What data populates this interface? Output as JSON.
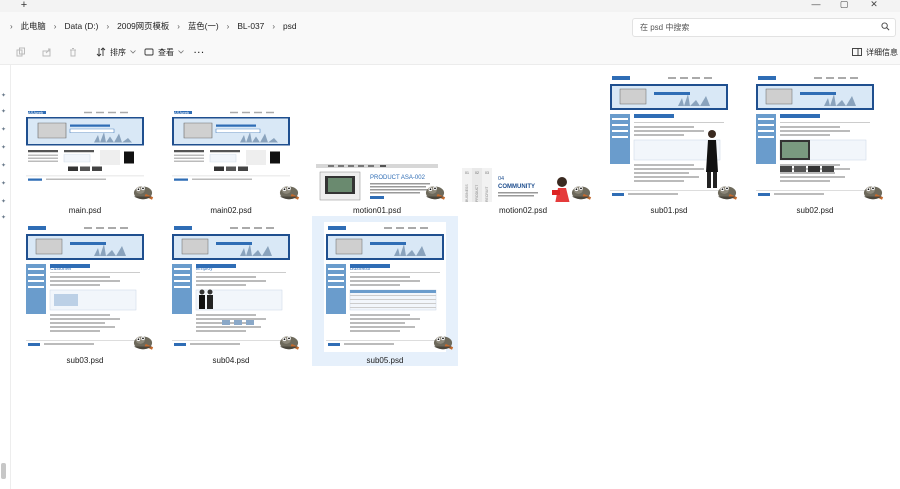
{
  "window": {
    "new_tab": "+",
    "minimize": "—",
    "maximize": "▢",
    "close": "✕"
  },
  "breadcrumb": [
    "此电脑",
    "Data (D:)",
    "2009网页模板",
    "蓝色(一)",
    "BL-037",
    "psd"
  ],
  "breadcrumb_sep": "›",
  "search": {
    "placeholder": "在 psd 中搜索"
  },
  "toolbar": {
    "sort_label": "排序",
    "view_label": "查看",
    "more_label": "···",
    "details_label": "详细信息"
  },
  "files": [
    {
      "name": "main.psd",
      "selected": false
    },
    {
      "name": "main02.psd",
      "selected": false
    },
    {
      "name": "motion01.psd",
      "selected": false
    },
    {
      "name": "motion02.psd",
      "selected": false
    },
    {
      "name": "sub01.psd",
      "selected": false
    },
    {
      "name": "sub02.psd",
      "selected": false
    },
    {
      "name": "sub03.psd",
      "selected": false
    },
    {
      "name": "sub04.psd",
      "selected": false
    },
    {
      "name": "sub05.psd",
      "selected": true
    }
  ],
  "thumb_text": {
    "logo": "ASAweb",
    "product_title": "PRODUCT ASA-002",
    "community_num": "04",
    "community_title": "COMMUNITY",
    "tab_labels": [
      "BUSINESS",
      "PRODUCT",
      "RECRUIT"
    ],
    "tab_nums": [
      "01",
      "02",
      "03"
    ],
    "customer": "Customer",
    "employ": "Employ",
    "business": "Business"
  },
  "colors": {
    "accent": "#2f6db5",
    "selected_bg": "#e6f0fb",
    "header_blue": "#1f4f8f",
    "side_blue": "#6a9ccc"
  }
}
